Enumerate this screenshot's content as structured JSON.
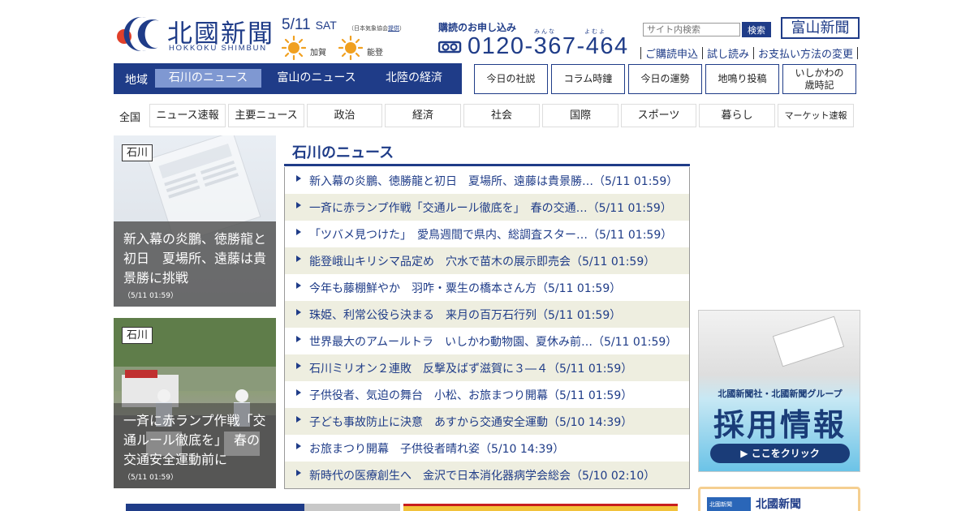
{
  "header": {
    "logo_jp": "北國新聞",
    "logo_en": "HOKKOKU SHIMBUN",
    "date": "5/11",
    "day_of_week": "SAT",
    "weather_credit_prefix": "（日本気象協会",
    "weather_credit_link": "提供",
    "weather_credit_suffix": "）",
    "weather": [
      {
        "area": "加賀",
        "icon": "sunny-icon"
      },
      {
        "area": "能登",
        "icon": "sunny-icon"
      }
    ],
    "subscription_title": "購読のお申し込み",
    "subscription_ruby1": "みんな",
    "subscription_ruby2": "よむよ",
    "subscription_phone": "0120-367-464",
    "search_placeholder": "サイト内検索",
    "search_button": "検索",
    "toyama_logo": "富山新聞",
    "links": [
      "ご購読申込",
      "試し読み",
      "お支払い方法の変更"
    ]
  },
  "region_nav": {
    "label": "地域",
    "tabs": [
      {
        "label": "石川のニュース",
        "active": true
      },
      {
        "label": "富山のニュース",
        "active": false
      },
      {
        "label": "北陸の経済",
        "active": false
      }
    ]
  },
  "box_links": [
    "今日の社説",
    "コラム時鐘",
    "今日の運勢",
    "地鳴り投稿",
    "いしかわの\n歳時記"
  ],
  "category_nav": {
    "label": "全国",
    "items": [
      "ニュース速報",
      "主要ニュース",
      "政治",
      "経済",
      "社会",
      "国際",
      "スポーツ",
      "暮らし",
      "マーケット速報"
    ]
  },
  "cards": [
    {
      "tag": "石川",
      "title": "新入幕の炎鵬、徳勝龍と初日　夏場所、遠藤は貴景勝に挑戦",
      "time": "（5/11 01:59）"
    },
    {
      "tag": "石川",
      "title": "一斉に赤ランプ作戦「交通ルール徹底を」　春の交通安全運動前に",
      "time": "（5/11 01:59）"
    }
  ],
  "news": {
    "heading": "石川のニュース",
    "items": [
      "新入幕の炎鵬、徳勝龍と初日　夏場所、遠藤は貴景勝…（5/11 01:59）",
      "一斉に赤ランプ作戦「交通ルール徹底を」　春の交通…（5/11 01:59）",
      "「ツバメ見つけた」　愛鳥週間で県内、総調査スター…（5/11 01:59）",
      "能登峨山キリシマ品定め　穴水で苗木の展示即売会（5/11 01:59）",
      "今年も藤棚鮮やか　羽咋・粟生の橋本さん方（5/11 01:59）",
      "珠姫、利常公役ら決まる　来月の百万石行列（5/11 01:59）",
      "世界最大のアムールトラ　いしかわ動物園、夏休み前…（5/11 01:59）",
      "石川ミリオン２連敗　反撃及ばず滋賀に３―４（5/11 01:59）",
      "子供役者、気迫の舞台　小松、お旅まつり開幕（5/11 01:59）",
      "子ども事故防止に決意　あすから交通安全運動（5/10 14:39）",
      "お旅まつり開幕　子供役者晴れ姿（5/10 14:39）",
      "新時代の医療創生へ　金沢で日本消化器病学会総会（5/10 02:10）"
    ]
  },
  "ad": {
    "company": "北國新聞社・北國新聞グループ",
    "title": "採用情報",
    "button": "▶ ここをクリック"
  },
  "mini_logo": {
    "blue_text": "北國新聞",
    "text": "北國新聞"
  },
  "colors": {
    "brand_blue": "#1f3c88",
    "active_tab": "#7f98d2",
    "row_alt": "#eeeee0",
    "sun": "#f0a020"
  }
}
